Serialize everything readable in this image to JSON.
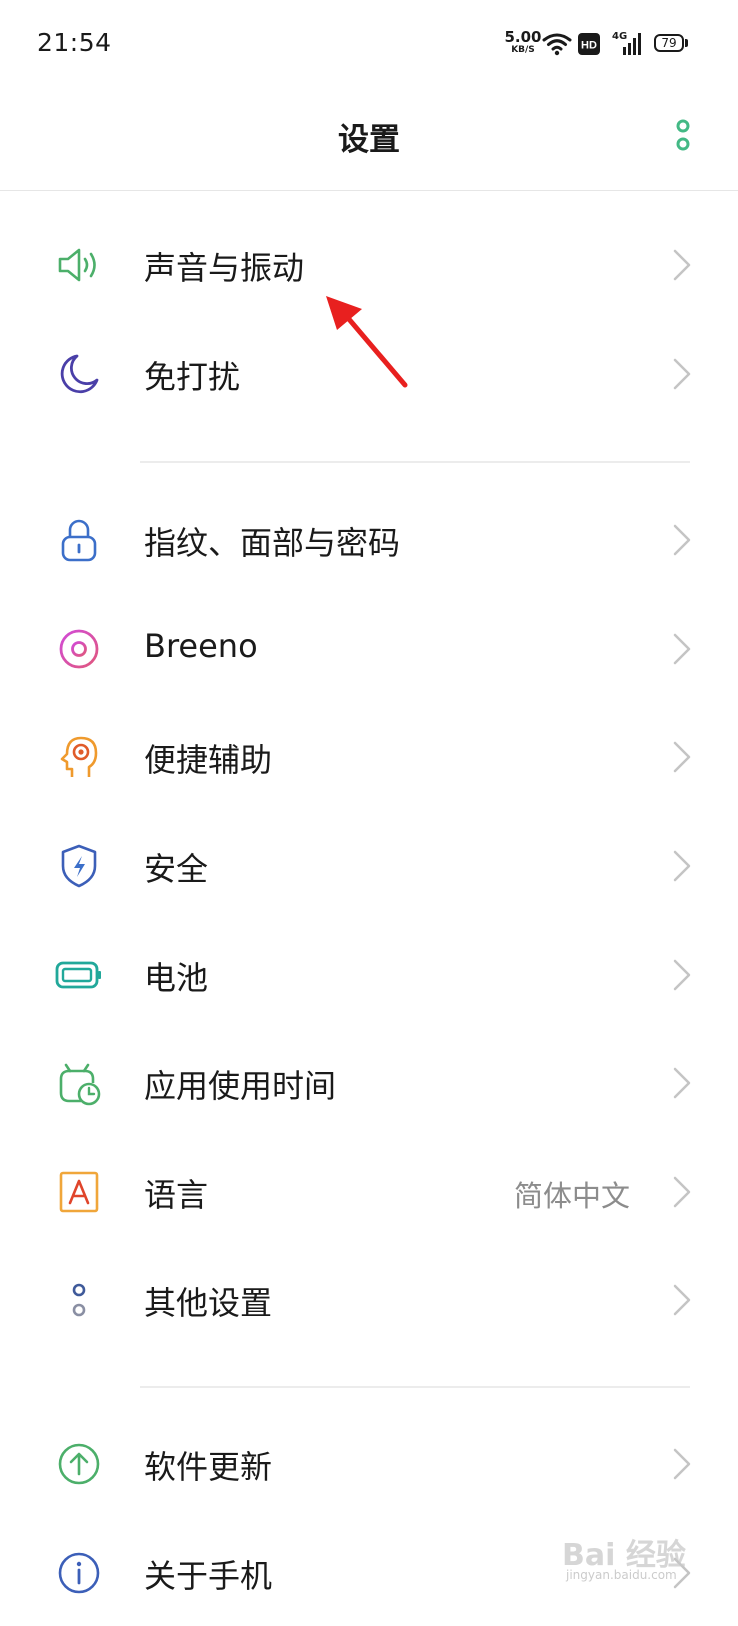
{
  "status_bar": {
    "time": "21:54",
    "net_speed_value": "5.00",
    "net_speed_unit": "KB/S",
    "hd_badge": "HD",
    "network_type": "4G",
    "battery_level": "79"
  },
  "header": {
    "title": "设置"
  },
  "rows": [
    {
      "label": "声音与振动",
      "icon": "speaker-icon"
    },
    {
      "label": "免打扰",
      "icon": "moon-icon"
    },
    {
      "label": "指纹、面部与密码",
      "icon": "lock-icon"
    },
    {
      "label": "Breeno",
      "icon": "breeno-icon"
    },
    {
      "label": "便捷辅助",
      "icon": "head-assist-icon"
    },
    {
      "label": "安全",
      "icon": "shield-icon"
    },
    {
      "label": "电池",
      "icon": "battery-icon"
    },
    {
      "label": "应用使用时间",
      "icon": "app-time-icon"
    },
    {
      "label": "语言",
      "value": "简体中文",
      "icon": "language-icon"
    },
    {
      "label": "其他设置",
      "icon": "dots-icon"
    },
    {
      "label": "软件更新",
      "icon": "update-arrow-icon"
    },
    {
      "label": "关于手机",
      "icon": "info-icon"
    }
  ],
  "colors": {
    "accent_green": "#43b985",
    "annotation_red": "#e8201f"
  },
  "watermark": {
    "brand": "Bai 经验",
    "url": "jingyan.baidu.com"
  }
}
